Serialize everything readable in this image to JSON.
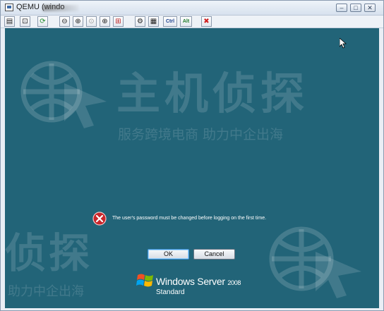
{
  "window": {
    "title": "QEMU (windo",
    "buttons": {
      "minimize": "–",
      "maximize": "□",
      "close": "✕"
    }
  },
  "toolbar": {
    "buttons": [
      {
        "name": "properties-button",
        "icon": "properties-icon",
        "glyph": "▤"
      },
      {
        "name": "save-button",
        "icon": "save-icon",
        "glyph": "⊡"
      },
      {
        "name": "refresh-button",
        "icon": "refresh-icon",
        "glyph": "⟳"
      },
      {
        "name": "zoom-out-button",
        "icon": "zoom-out-icon",
        "glyph": "⊖"
      },
      {
        "name": "zoom-in-button",
        "icon": "zoom-in-icon",
        "glyph": "⊕"
      },
      {
        "name": "zoom-reset-button",
        "icon": "zoom-reset-icon",
        "glyph": "⊙"
      },
      {
        "name": "zoom-auto-button",
        "icon": "zoom-auto-icon",
        "glyph": "⊕"
      },
      {
        "name": "fullscreen-button",
        "icon": "fullscreen-icon",
        "glyph": "⊞"
      },
      {
        "name": "options-button",
        "icon": "options-icon",
        "glyph": "⚙"
      },
      {
        "name": "clipboard-button",
        "icon": "clipboard-icon",
        "glyph": "▦"
      },
      {
        "name": "ctrl-key-button",
        "label": "Ctrl"
      },
      {
        "name": "alt-key-button",
        "label": "Alt"
      },
      {
        "name": "disconnect-button",
        "icon": "disconnect-icon",
        "glyph": "✖"
      }
    ]
  },
  "dialog": {
    "message": "The user's password must be changed before logging on the first time.",
    "ok_label": "OK",
    "cancel_label": "Cancel"
  },
  "branding": {
    "product": "Windows Server",
    "version": "2008",
    "edition": "Standard"
  },
  "watermark": {
    "brand": "主机侦探",
    "slogan": "服务跨境电商  助力中企出海",
    "slogan_short": "助力中企出海",
    "brand_partial": "侦探"
  },
  "colors": {
    "desktop": "#226478",
    "error_red": "#c8262b",
    "ok_border": "#3d93d8"
  }
}
